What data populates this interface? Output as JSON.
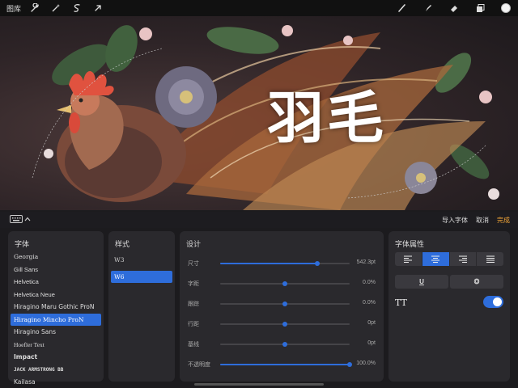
{
  "topbar": {
    "gallery_label": "图库",
    "tools_left": [
      "wrench-icon",
      "magic-wand-icon",
      "selection-icon",
      "transform-arrow-icon"
    ],
    "tools_right": [
      "brush-icon",
      "smudge-icon",
      "eraser-icon",
      "layers-icon"
    ],
    "active_color": "#f5f5f5"
  },
  "canvas": {
    "artwork_title": "羽毛"
  },
  "text_panel_bar": {
    "import_font_label": "导入字体",
    "cancel_label": "取消",
    "done_label": "完成"
  },
  "font_panel": {
    "title": "字体",
    "fonts": [
      {
        "name": "Georgia",
        "selected": false
      },
      {
        "name": "Gill Sans",
        "selected": false
      },
      {
        "name": "Helvetica",
        "selected": false
      },
      {
        "name": "Helvetica Neue",
        "selected": false
      },
      {
        "name": "Hiragino Maru Gothic ProN",
        "selected": false
      },
      {
        "name": "Hiragino Mincho ProN",
        "selected": true
      },
      {
        "name": "Hiragino Sans",
        "selected": false
      },
      {
        "name": "Hoefler Text",
        "selected": false
      },
      {
        "name": "Impact",
        "selected": false
      },
      {
        "name": "JACK ARMSTRONG BB",
        "selected": false
      },
      {
        "name": "Kailasa",
        "selected": false
      }
    ]
  },
  "style_panel": {
    "title": "样式",
    "styles": [
      {
        "name": "W3",
        "selected": false
      },
      {
        "name": "W6",
        "selected": true
      }
    ]
  },
  "design_panel": {
    "title": "设计",
    "sliders": [
      {
        "label": "尺寸",
        "value": "542.3pt",
        "fraction": 0.75
      },
      {
        "label": "字距",
        "value": "0.0%",
        "fraction": 0.5
      },
      {
        "label": "跟踪",
        "value": "0.0%",
        "fraction": 0.5
      },
      {
        "label": "行距",
        "value": "0pt",
        "fraction": 0.5
      },
      {
        "label": "基线",
        "value": "0pt",
        "fraction": 0.5
      },
      {
        "label": "不透明度",
        "value": "100.0%",
        "fraction": 1.0
      }
    ]
  },
  "attributes_panel": {
    "title": "字体属性",
    "alignments": [
      {
        "icon": "align-left-icon",
        "selected": false
      },
      {
        "icon": "align-center-icon",
        "selected": true
      },
      {
        "icon": "align-right-icon",
        "selected": false
      },
      {
        "icon": "align-justify-icon",
        "selected": false
      }
    ],
    "underline_label": "U",
    "outline_label": "O",
    "all_caps_label": "TT",
    "all_caps_enabled": true
  },
  "colors": {
    "accent": "#2e6ddb",
    "done": "#f0a437",
    "panel_bg": "#2a292d"
  }
}
